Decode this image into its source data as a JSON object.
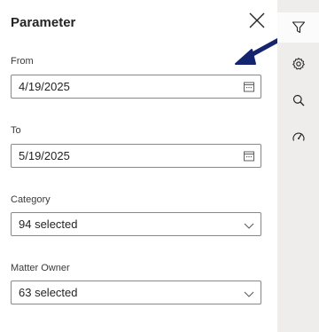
{
  "panel": {
    "title": "Parameter",
    "from": {
      "label": "From",
      "value": "4/19/2025"
    },
    "to": {
      "label": "To",
      "value": "5/19/2025"
    },
    "category": {
      "label": "Category",
      "value": "94 selected"
    },
    "matter_owner": {
      "label": "Matter Owner",
      "value": "63 selected"
    }
  },
  "rail": {
    "items": [
      {
        "icon": "filter-icon",
        "active": true
      },
      {
        "icon": "gear-icon",
        "active": false
      },
      {
        "icon": "search-icon",
        "active": false
      },
      {
        "icon": "gauge-icon",
        "active": false
      }
    ]
  },
  "annotation": {
    "icon": "arrow-icon",
    "color": "#14246e"
  }
}
